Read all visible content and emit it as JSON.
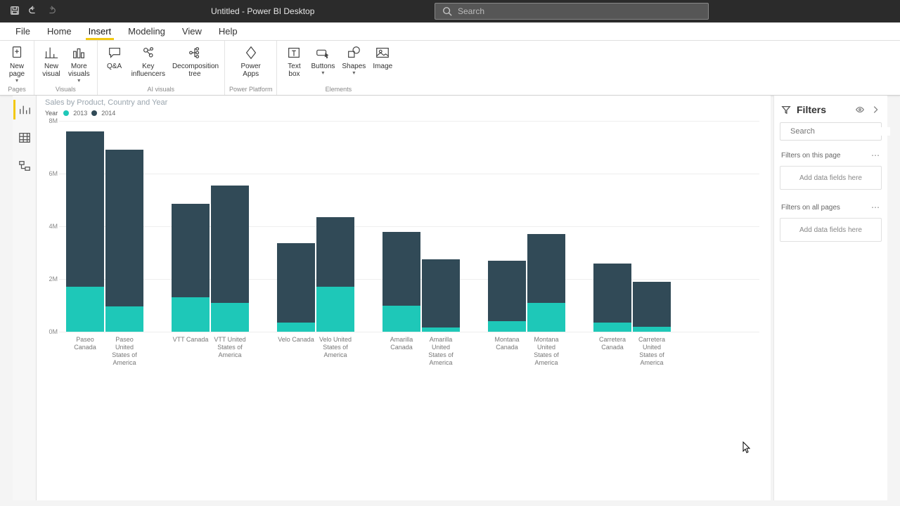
{
  "titlebar": {
    "title": "Untitled - Power BI Desktop",
    "search_placeholder": "Search"
  },
  "tabs": {
    "file": "File",
    "home": "Home",
    "insert": "Insert",
    "modeling": "Modeling",
    "view": "View",
    "help": "Help"
  },
  "ribbon": {
    "pages_group": "Pages",
    "visuals_group": "Visuals",
    "ai_group": "AI visuals",
    "power_group": "Power Platform",
    "elements_group": "Elements",
    "new_page": "New\npage",
    "new_visual": "New\nvisual",
    "more_visuals": "More\nvisuals",
    "qna": "Q&A",
    "key_influencers": "Key\ninfluencers",
    "decomp": "Decomposition\ntree",
    "power_apps": "Power\nApps",
    "textbox": "Text\nbox",
    "buttons": "Buttons",
    "shapes": "Shapes",
    "image": "Image"
  },
  "filters": {
    "title": "Filters",
    "search_placeholder": "Search",
    "page_header": "Filters on this page",
    "page_drop": "Add data fields here",
    "all_header": "Filters on all pages",
    "all_drop": "Add data fields here"
  },
  "chart_data": {
    "type": "bar",
    "title": "Sales by Product, Country and Year",
    "legend_title": "Year",
    "ylabel": "",
    "xlabel": "",
    "ylim": [
      0,
      8000000
    ],
    "yticks": [
      0,
      2000000,
      4000000,
      6000000,
      8000000
    ],
    "ytick_labels": [
      "0M",
      "2M",
      "4M",
      "6M",
      "8M"
    ],
    "colors": {
      "2013": "#1ec8b8",
      "2014": "#314a57"
    },
    "series_names": [
      "2013",
      "2014"
    ],
    "categories": [
      "Paseo Canada",
      "Paseo United States of America",
      "VTT Canada",
      "VTT United States of America",
      "Velo Canada",
      "Velo United States of America",
      "Amarilla Canada",
      "Amarilla United States of America",
      "Montana Canada",
      "Montana United States of America",
      "Carretera Canada",
      "Carretera United States of America"
    ],
    "series": [
      {
        "name": "2013",
        "values": [
          1700000,
          950000,
          1300000,
          1100000,
          350000,
          1700000,
          1000000,
          150000,
          400000,
          1100000,
          350000,
          200000
        ]
      },
      {
        "name": "2014",
        "values": [
          5900000,
          5950000,
          3550000,
          4450000,
          3000000,
          2650000,
          2800000,
          2600000,
          2300000,
          2600000,
          2250000,
          1700000
        ]
      }
    ]
  }
}
